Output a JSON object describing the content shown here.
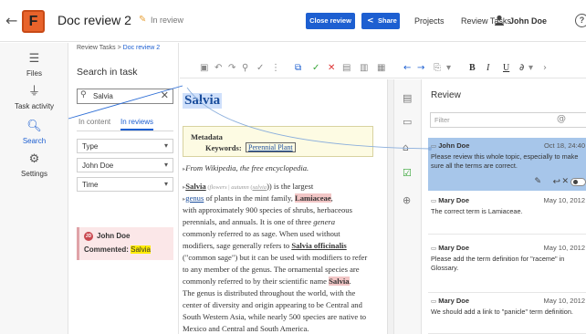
{
  "header": {
    "doc_title": "Doc review 2",
    "status": "In review",
    "close_review": "Close review",
    "share": "Share",
    "nav": [
      "Projects",
      "Review Tasks"
    ],
    "user": "John Doe"
  },
  "rail": {
    "items": [
      {
        "label": "Files",
        "icon": "files-icon"
      },
      {
        "label": "Task activity",
        "icon": "activity-icon"
      },
      {
        "label": "Search",
        "icon": "search-icon"
      },
      {
        "label": "Settings",
        "icon": "gear-icon"
      }
    ]
  },
  "search_panel": {
    "breadcrumb_root": "Review Tasks >",
    "breadcrumb_current": "Doc review 2",
    "title": "Search in task",
    "query": "Salvia",
    "tabs": [
      "In content",
      "In reviews"
    ],
    "filters": [
      "Type",
      "John Doe",
      "Time"
    ],
    "result": {
      "avatar": "JD",
      "user": "John Doe",
      "prefix": "Commented:",
      "match": "Salvia"
    }
  },
  "editor": {
    "title": "Salvia",
    "metadata_label": "Metadata",
    "keywords_label": "Keywords:",
    "keyword": "Perennial Plant",
    "intro": "From Wikipedia, the free encyclopedia.",
    "lines": [
      {
        "a": "Salvia",
        "b": " (",
        "c": "flowers",
        "d": " | ",
        "e": "autumn",
        "f": " (",
        "g": "salvia",
        "h": ")) is the largest"
      },
      {
        "a": "genus",
        "b": " of plants in the mint family, ",
        "c": "Lamiaceae",
        "d": ","
      },
      {
        "text": "with approximately 900 species of shrubs, herbaceous"
      },
      {
        "a": "perennials, and annuals. It is one of three ",
        "b": "genera"
      },
      {
        "text": "commonly referred to as sage. When used without"
      },
      {
        "a": "modifiers, sage generally refers to ",
        "b": "Salvia officinalis"
      },
      {
        "text": "(\"common sage\") but it can be used with modifiers to refer"
      },
      {
        "text": "to any member of the genus. The ornamental species are"
      },
      {
        "a": "commonly referred to by their scientific name ",
        "b": "Salvia",
        "c": "."
      },
      {
        "text": "The genus is distributed throughout the world, with the"
      },
      {
        "text": "center of diversity and origin appearing to be Central and"
      },
      {
        "text": "South Western Asia, while nearly 500 species are native to"
      },
      {
        "text": "Mexico and Central and South America."
      }
    ]
  },
  "review": {
    "title": "Review",
    "filter_placeholder": "Filter",
    "cards": [
      {
        "user": "John Doe",
        "date": "Oct 18, 24:40",
        "text": "Please review this whole topic, especially to make sure all the terms are correct."
      },
      {
        "user": "Mary Doe",
        "date": "May 10, 2012",
        "text": "The correct term is Lamiaceae."
      },
      {
        "user": "Mary Doe",
        "date": "May 10, 2012",
        "text": "Please add the term definition for \"raceme\" in Glossary."
      },
      {
        "user": "Mary Doe",
        "date": "May 10, 2012",
        "text": "We should add a link to \"panicle\" term definition."
      }
    ]
  },
  "colors": {
    "accent": "#1d5fd1",
    "logo": "#e8632b",
    "selected_card": "#a7c6ea",
    "search_highlight": "#ffec00"
  }
}
